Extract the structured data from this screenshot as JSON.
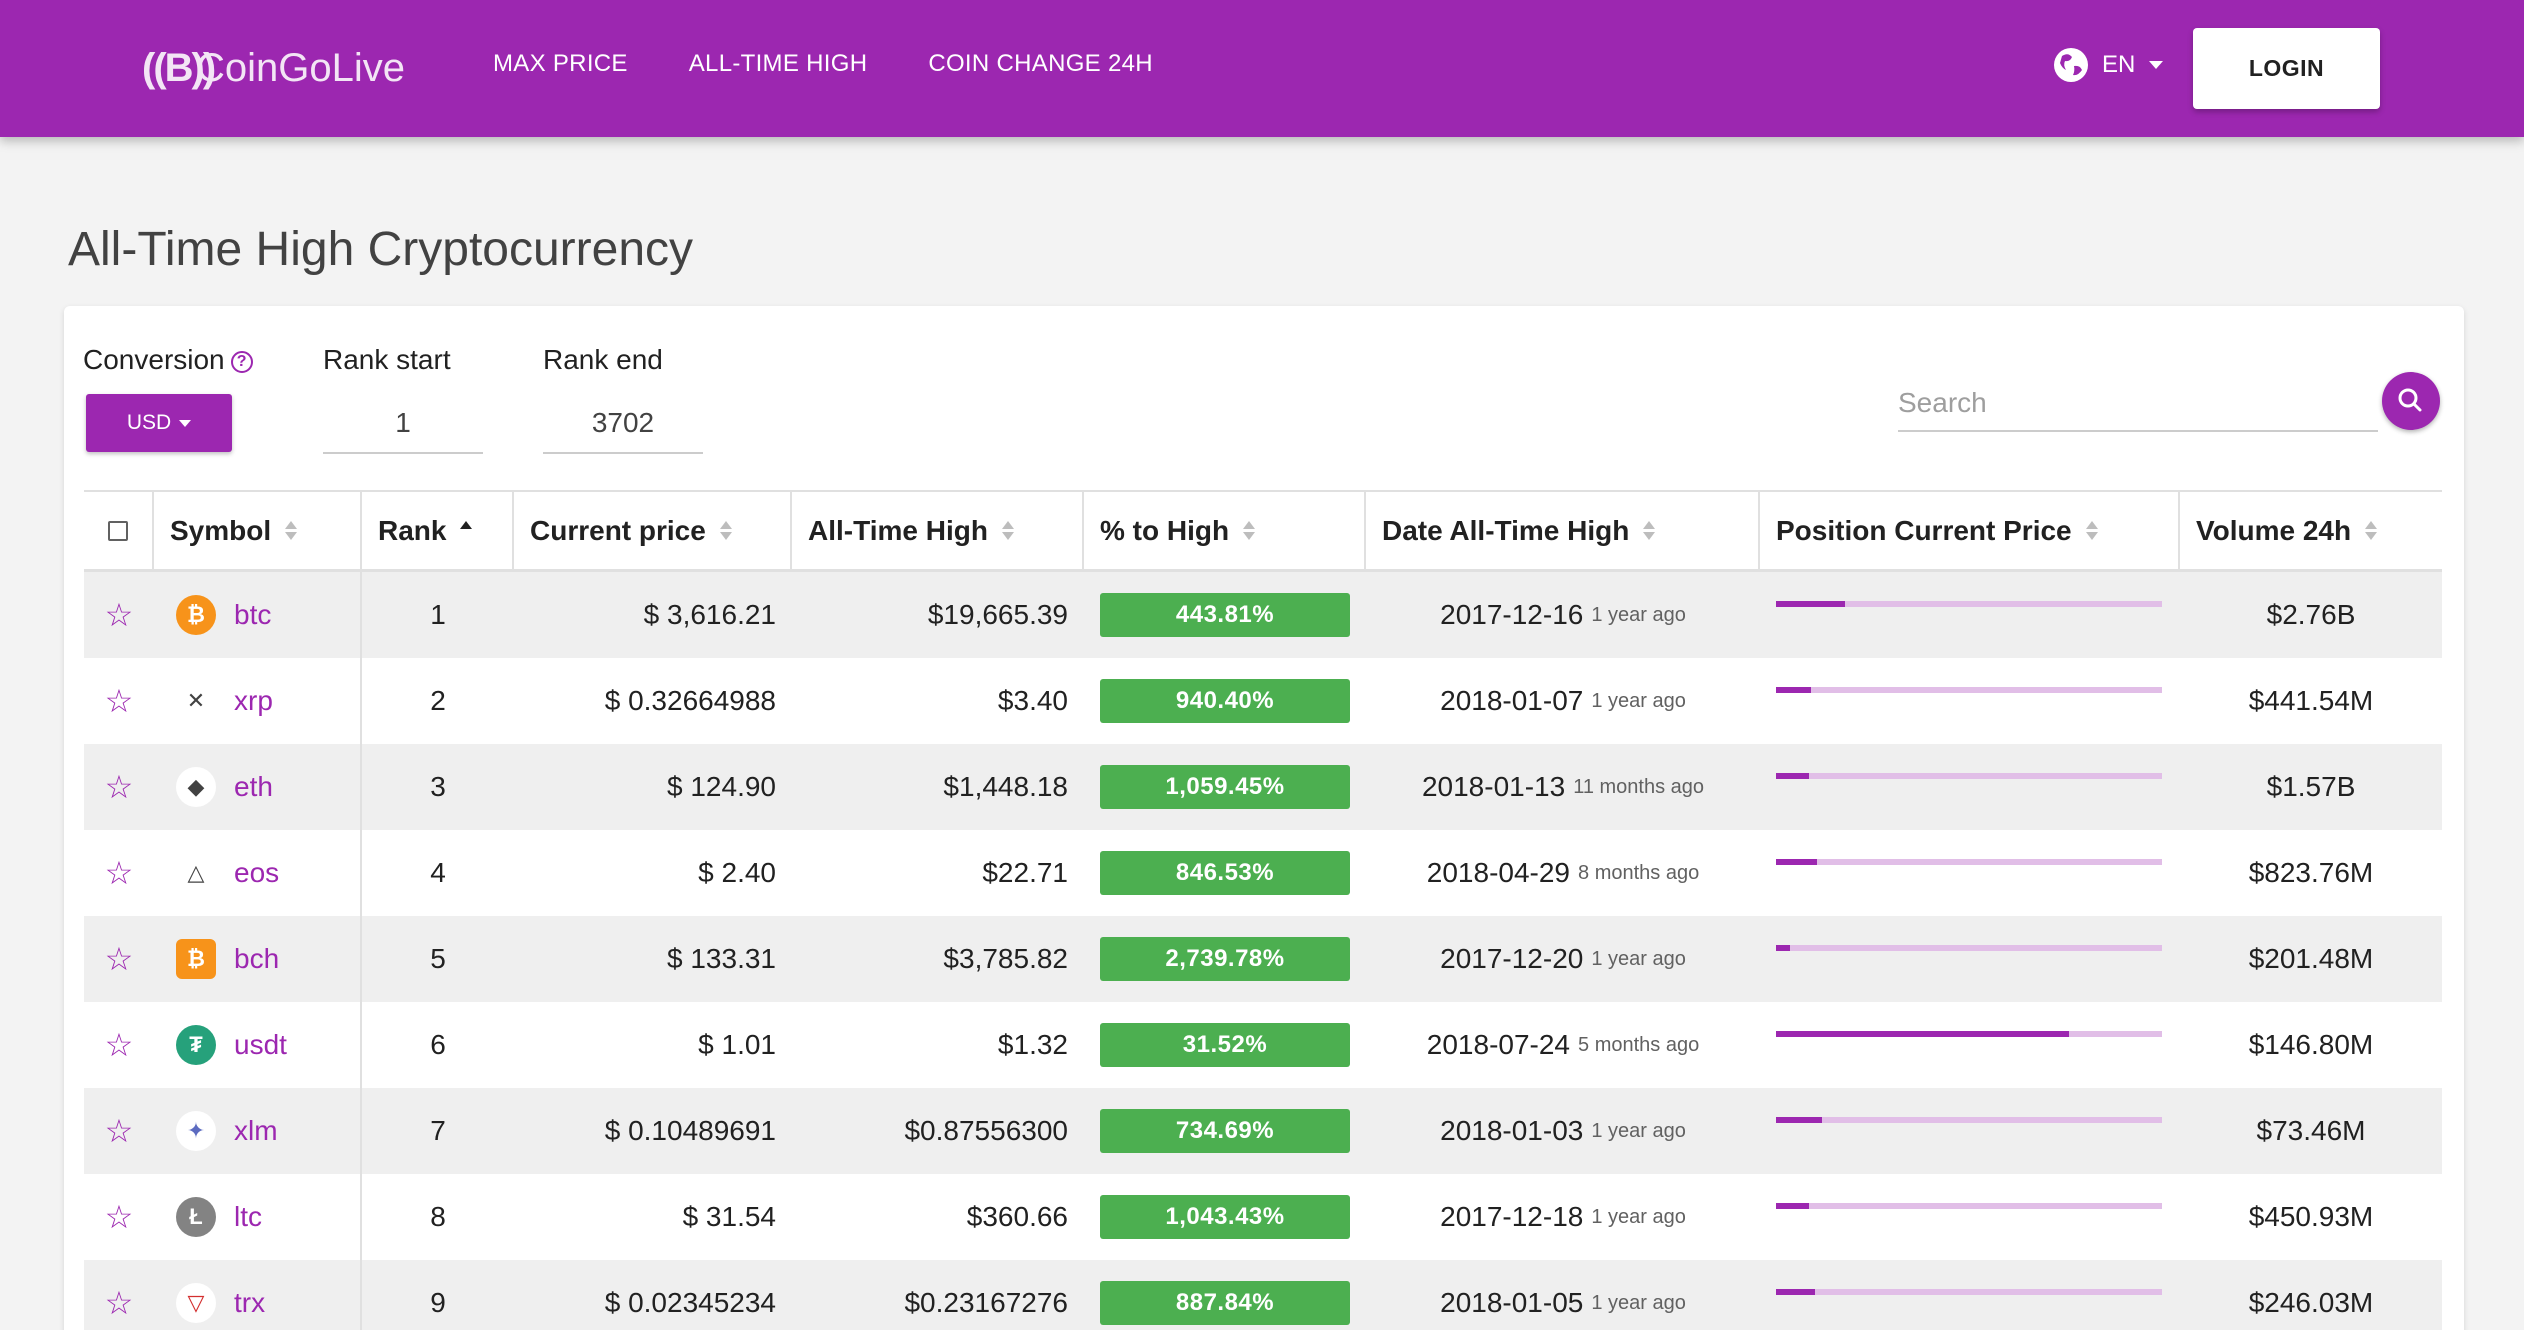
{
  "brand": {
    "logo": "((B))",
    "name": "CoinGoLive"
  },
  "nav": [
    "MAX PRICE",
    "ALL-TIME HIGH",
    "COIN CHANGE 24H"
  ],
  "lang": "EN",
  "login_label": "LOGIN",
  "page_title": "All-Time High Cryptocurrency",
  "filters": {
    "conversion_label": "Conversion",
    "conversion_value": "USD",
    "rank_start_label": "Rank start",
    "rank_start_value": "1",
    "rank_end_label": "Rank end",
    "rank_end_value": "3702",
    "search_placeholder": "Search"
  },
  "columns": [
    "Symbol",
    "Rank",
    "Current price",
    "All-Time High",
    "% to High",
    "Date All-Time High",
    "Position Current Price",
    "Volume 24h"
  ],
  "colors": {
    "brand": "#9c27b0",
    "pct_badge": "#4caf50",
    "bar_track": "#e1bee7"
  },
  "rows": [
    {
      "symbol": "btc",
      "icon": "bitcoin-icon",
      "icon_color": "#f7931a",
      "icon_glyph": "₿",
      "rank": "1",
      "price": "$ 3,616.21",
      "ath": "$19,665.39",
      "pct": "443.81%",
      "date": "2017-12-16",
      "ago": "1 year ago",
      "position": 0.18,
      "volume": "$2.76B"
    },
    {
      "symbol": "xrp",
      "icon": "ripple-icon",
      "icon_color": "#ffffff",
      "icon_glyph": "✕",
      "rank": "2",
      "price": "$ 0.32664988",
      "ath": "$3.40",
      "pct": "940.40%",
      "date": "2018-01-07",
      "ago": "1 year ago",
      "position": 0.09,
      "volume": "$441.54M"
    },
    {
      "symbol": "eth",
      "icon": "ethereum-icon",
      "icon_color": "#ffffff",
      "icon_glyph": "◆",
      "rank": "3",
      "price": "$ 124.90",
      "ath": "$1,448.18",
      "pct": "1,059.45%",
      "date": "2018-01-13",
      "ago": "11 months ago",
      "position": 0.085,
      "volume": "$1.57B"
    },
    {
      "symbol": "eos",
      "icon": "eos-icon",
      "icon_color": "#ffffff",
      "icon_glyph": "△",
      "rank": "4",
      "price": "$ 2.40",
      "ath": "$22.71",
      "pct": "846.53%",
      "date": "2018-04-29",
      "ago": "8 months ago",
      "position": 0.105,
      "volume": "$823.76M"
    },
    {
      "symbol": "bch",
      "icon": "bitcoin-cash-icon",
      "icon_color": "#f7931a",
      "icon_glyph": "₿",
      "rank": "5",
      "price": "$ 133.31",
      "ath": "$3,785.82",
      "pct": "2,739.78%",
      "date": "2017-12-20",
      "ago": "1 year ago",
      "position": 0.035,
      "volume": "$201.48M"
    },
    {
      "symbol": "usdt",
      "icon": "tether-icon",
      "icon_color": "#26a17b",
      "icon_glyph": "₮",
      "rank": "6",
      "price": "$ 1.01",
      "ath": "$1.32",
      "pct": "31.52%",
      "date": "2018-07-24",
      "ago": "5 months ago",
      "position": 0.76,
      "volume": "$146.80M"
    },
    {
      "symbol": "xlm",
      "icon": "stellar-icon",
      "icon_color": "#ffffff",
      "icon_glyph": "✦",
      "rank": "7",
      "price": "$ 0.10489691",
      "ath": "$0.87556300",
      "pct": "734.69%",
      "date": "2018-01-03",
      "ago": "1 year ago",
      "position": 0.12,
      "volume": "$73.46M"
    },
    {
      "symbol": "ltc",
      "icon": "litecoin-icon",
      "icon_color": "#838383",
      "icon_glyph": "Ł",
      "rank": "8",
      "price": "$ 31.54",
      "ath": "$360.66",
      "pct": "1,043.43%",
      "date": "2017-12-18",
      "ago": "1 year ago",
      "position": 0.085,
      "volume": "$450.93M"
    },
    {
      "symbol": "trx",
      "icon": "tron-icon",
      "icon_color": "#ffffff",
      "icon_glyph": "▽",
      "rank": "9",
      "price": "$ 0.02345234",
      "ath": "$0.23167276",
      "pct": "887.84%",
      "date": "2018-01-05",
      "ago": "1 year ago",
      "position": 0.1,
      "volume": "$246.03M"
    }
  ]
}
